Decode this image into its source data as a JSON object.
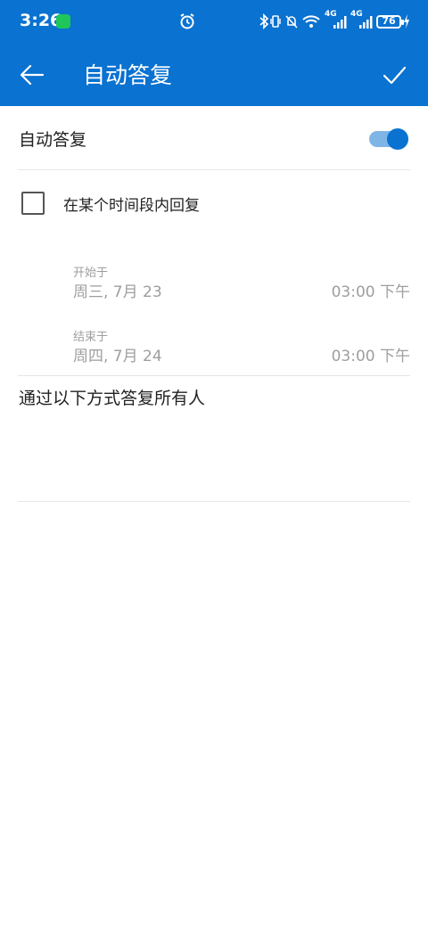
{
  "status_bar": {
    "time": "3:26",
    "icons": [
      "wechat-icon",
      "alarm-icon",
      "bluetooth-icon",
      "vibrate-icon",
      "mute-icon",
      "wifi-icon",
      "signal-4g-icon",
      "signal-4g-icon"
    ],
    "network_1": "4G",
    "network_2": "4G",
    "battery": "76"
  },
  "app_bar": {
    "title": "自动答复",
    "back_icon": "arrow-left-icon",
    "confirm_icon": "check-icon",
    "color": "#0a72d0"
  },
  "auto_reply": {
    "label": "自动答复",
    "enabled": true
  },
  "time_range": {
    "label": "在某个时间段内回复",
    "checked": false,
    "start": {
      "caption": "开始于",
      "date": "周三, 7月 23",
      "time": "03:00 下午"
    },
    "end": {
      "caption": "结束于",
      "date": "周四, 7月 24",
      "time": "03:00 下午"
    }
  },
  "reply_all": {
    "label": "通过以下方式答复所有人",
    "message": ""
  }
}
